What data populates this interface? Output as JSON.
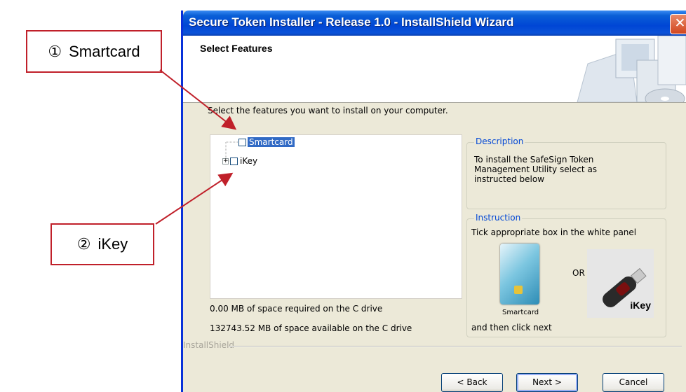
{
  "callouts": [
    {
      "number": "①",
      "label": "Smartcard"
    },
    {
      "number": "②",
      "label": "iKey"
    }
  ],
  "window": {
    "title": "Secure Token Installer - Release 1.0 - InstallShield Wizard",
    "close_glyph": "✕"
  },
  "header": {
    "title": "Select Features"
  },
  "prompt": "Select the features you want to install on your computer.",
  "tree": {
    "items": [
      {
        "label": "Smartcard",
        "checked": false,
        "selected": true,
        "expander": ""
      },
      {
        "label": "iKey",
        "checked": false,
        "selected": false,
        "expander": "+"
      }
    ]
  },
  "space": {
    "required": "0.00 MB of space required on the C drive",
    "available": "132743.52 MB of space available on the C drive"
  },
  "description": {
    "legend": "Description",
    "text": "To install the SafeSign Token Management Utility select as instructed below"
  },
  "instruction": {
    "legend": "Instruction",
    "text": "Tick appropriate box in the white panel",
    "smartcard_caption": "Smartcard",
    "or": "OR",
    "ikey_caption": "iKey",
    "then": "and then click next"
  },
  "footer": {
    "brand": "InstallShield"
  },
  "buttons": {
    "back": "< Back",
    "next": "Next >",
    "cancel": "Cancel"
  },
  "colors": {
    "titlebar": "#0046d5",
    "callout_border": "#c0202a",
    "selection": "#316ac5",
    "window_bg": "#ece9d8"
  }
}
